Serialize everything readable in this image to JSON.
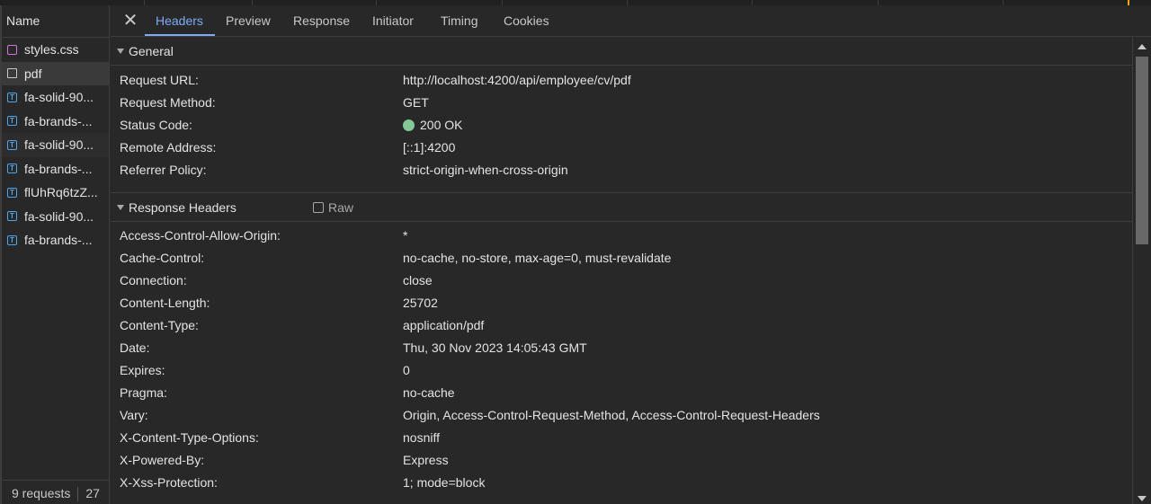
{
  "left": {
    "header": "Name",
    "requests": [
      {
        "name": "styles.css",
        "icon": "css-file-icon"
      },
      {
        "name": "pdf",
        "icon": "document-icon"
      },
      {
        "name": "fa-solid-90...",
        "icon": "font-file-icon"
      },
      {
        "name": "fa-brands-...",
        "icon": "font-file-icon"
      },
      {
        "name": "fa-solid-90...",
        "icon": "font-file-icon"
      },
      {
        "name": "fa-brands-...",
        "icon": "font-file-icon"
      },
      {
        "name": "flUhRq6tzZ...",
        "icon": "font-file-icon"
      },
      {
        "name": "fa-solid-90...",
        "icon": "font-file-icon"
      },
      {
        "name": "fa-brands-...",
        "icon": "font-file-icon"
      }
    ],
    "footer": {
      "requests": "9 requests",
      "size": "27"
    }
  },
  "tabs": {
    "close": "✕",
    "items": [
      "Headers",
      "Preview",
      "Response",
      "Initiator",
      "Timing",
      "Cookies"
    ],
    "active": "Headers"
  },
  "general": {
    "title": "General",
    "rows": [
      {
        "k": "Request URL:",
        "v": "http://localhost:4200/api/employee/cv/pdf"
      },
      {
        "k": "Request Method:",
        "v": "GET"
      },
      {
        "k": "Status Code:",
        "v": "200 OK"
      },
      {
        "k": "Remote Address:",
        "v": "[::1]:4200"
      },
      {
        "k": "Referrer Policy:",
        "v": "strict-origin-when-cross-origin"
      }
    ]
  },
  "response_headers": {
    "title": "Response Headers",
    "raw_label": "Raw",
    "rows": [
      {
        "k": "Access-Control-Allow-Origin:",
        "v": "*"
      },
      {
        "k": "Cache-Control:",
        "v": "no-cache, no-store, max-age=0, must-revalidate"
      },
      {
        "k": "Connection:",
        "v": "close"
      },
      {
        "k": "Content-Length:",
        "v": "25702"
      },
      {
        "k": "Content-Type:",
        "v": "application/pdf"
      },
      {
        "k": "Date:",
        "v": "Thu, 30 Nov 2023 14:05:43 GMT"
      },
      {
        "k": "Expires:",
        "v": "0"
      },
      {
        "k": "Pragma:",
        "v": "no-cache"
      },
      {
        "k": "Vary:",
        "v": "Origin, Access-Control-Request-Method, Access-Control-Request-Headers"
      },
      {
        "k": "X-Content-Type-Options:",
        "v": "nosniff"
      },
      {
        "k": "X-Powered-By:",
        "v": "Express"
      },
      {
        "k": "X-Xss-Protection:",
        "v": "1; mode=block"
      }
    ]
  },
  "colors": {
    "accent": "#7cacf8",
    "status_ok": "#81c995",
    "background": "#282828"
  }
}
